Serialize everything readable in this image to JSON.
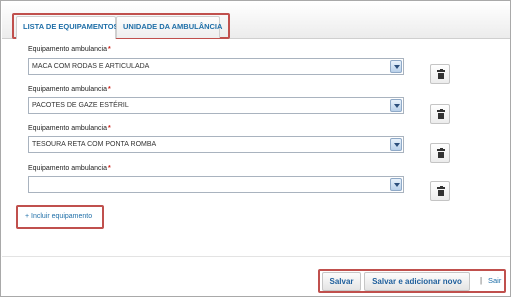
{
  "tabs": [
    {
      "label": "LISTA DE EQUIPAMENTOS",
      "active": true
    },
    {
      "label": "UNIDADE DA AMBULÂNCIA",
      "active": false
    }
  ],
  "fields": [
    {
      "label": "Equipamento ambulancia",
      "required_mark": "*",
      "value": "MACA COM RODAS E ARTICULADA"
    },
    {
      "label": "Equipamento ambulancia",
      "required_mark": "*",
      "value": "PACOTES DE GAZE ESTÉRIL"
    },
    {
      "label": "Equipamento ambulancia",
      "required_mark": "*",
      "value": "TESOURA RETA COM PONTA ROMBA"
    },
    {
      "label": "Equipamento ambulancia",
      "required_mark": "*",
      "value": ""
    }
  ],
  "add_link": "+ Incluir equipamento",
  "footer": {
    "save_label": "Salvar",
    "save_new_label": "Salvar e adicionar novo",
    "separator": "|",
    "exit_label": "Sair"
  },
  "colors": {
    "link": "#1f6fa8",
    "required": "#d2231b",
    "highlight": "#c0504d"
  },
  "icons": {
    "delete": "trash-icon",
    "dropdown": "chevron-down-icon"
  }
}
